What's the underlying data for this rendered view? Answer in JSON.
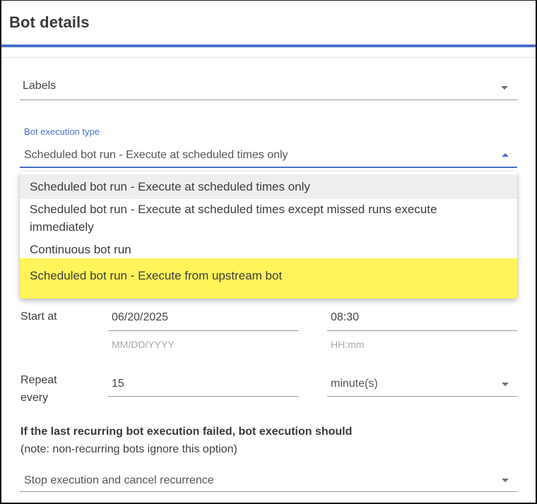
{
  "header": {
    "title": "Bot details"
  },
  "labels_field": {
    "placeholder": "Labels"
  },
  "execution_type": {
    "label": "Bot execution type",
    "value": "Scheduled bot run - Execute at scheduled times only",
    "options": [
      "Scheduled bot run - Execute at scheduled times only",
      "Scheduled bot run - Execute at scheduled times except missed runs execute immediately",
      "Continuous bot run",
      "Scheduled bot run - Execute from upstream bot"
    ],
    "selected_index": 0,
    "highlighted_index": 3
  },
  "start_at": {
    "label": "Start at",
    "date": "06/20/2025",
    "date_hint": "MM/DD/YYYY",
    "time": "08:30",
    "time_hint": "HH:mm"
  },
  "repeat": {
    "label_line1": "Repeat",
    "label_line2": "every",
    "value": "15",
    "unit": "minute(s)"
  },
  "failure": {
    "heading": "If the last recurring bot execution failed, bot execution should",
    "note": "(note: non-recurring bots ignore this option)",
    "value": "Stop execution and cancel recurrence"
  },
  "colors": {
    "accent": "#4a6fca",
    "highlight": "#fff45a"
  }
}
